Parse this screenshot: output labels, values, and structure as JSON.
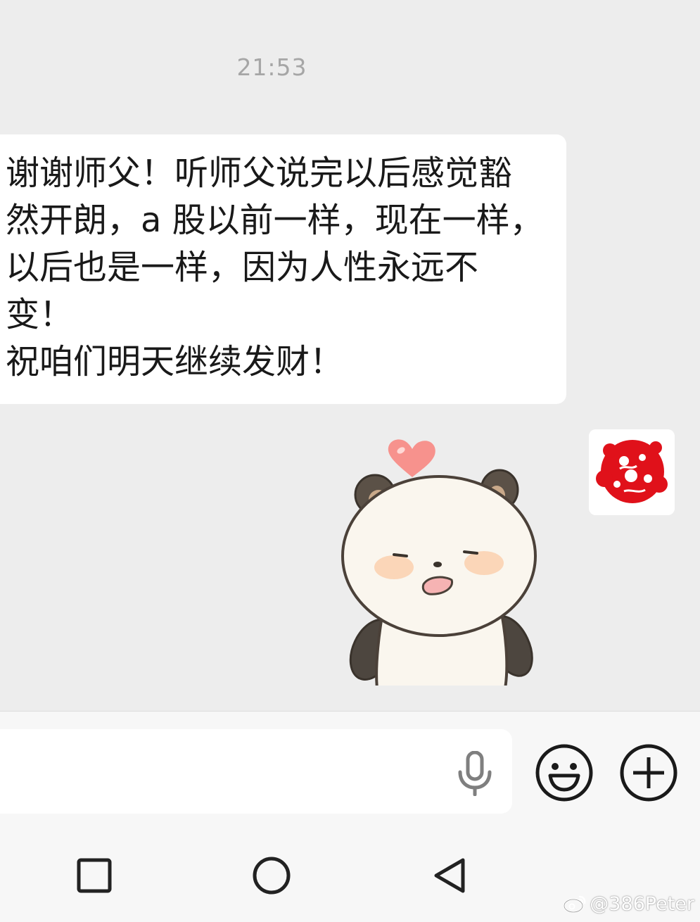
{
  "chat": {
    "timestamp": "21:53",
    "messages": [
      {
        "text": "谢谢师父！听师父说完以后感觉豁\n然开朗，a 股以前一样，现在一样，\n以后也是一样，因为人性永远不\n变！\n祝咱们明天继续发财！"
      }
    ],
    "sticker": {
      "icon": "panda-sticker-with-heart"
    },
    "avatar": {
      "icon": "red-papercut-avatar"
    }
  },
  "input": {
    "value": "",
    "placeholder": "",
    "mic_icon": "microphone-icon",
    "emoji_icon": "emoji-smile-icon",
    "plus_icon": "plus-circle-icon"
  },
  "nav": {
    "recents_icon": "square-icon",
    "home_icon": "circle-icon",
    "back_icon": "triangle-back-icon"
  },
  "watermark": {
    "text": "@386Peter"
  },
  "colors": {
    "background": "#ededed",
    "bubble": "#ffffff",
    "timestamp": "#a6a6a6",
    "avatar_red": "#e0111a",
    "heart_pink": "#f7928d"
  }
}
